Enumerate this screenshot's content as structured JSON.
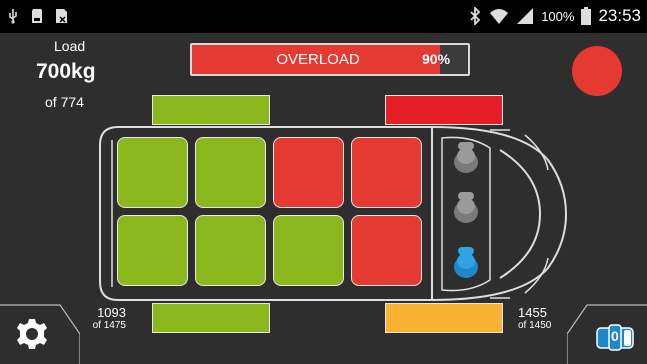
{
  "status_bar": {
    "battery_percent": "100%",
    "time": "23:53",
    "left_icons": [
      "usb-icon",
      "sd-card-icon",
      "sim-icon"
    ],
    "right_icons": [
      "bluetooth-icon",
      "wifi-icon",
      "signal-icon",
      "battery-icon"
    ]
  },
  "load": {
    "title": "Load",
    "value": "700kg",
    "capacity": "of 774"
  },
  "overload_bar": {
    "label": "OVERLOAD",
    "percent_label": "90%",
    "fill_fraction": 0.9,
    "color": "#e53a32"
  },
  "status_indicator": {
    "color": "#e53a32"
  },
  "axles": {
    "front_left_color": "#8cb81f",
    "front_right_color": "#e51e25",
    "rear_left_color": "#8cb81f",
    "rear_right_color": "#f9b233"
  },
  "grid": {
    "rows": [
      [
        "green",
        "green",
        "red",
        "red"
      ],
      [
        "green",
        "green",
        "green",
        "red"
      ]
    ]
  },
  "seats": [
    "gray",
    "gray",
    "blue"
  ],
  "weights": {
    "left": {
      "value": "1093",
      "of": "of 1475"
    },
    "right": {
      "value": "1455",
      "of": "of 1450"
    }
  },
  "buttons": {
    "settings_icon": "gear-icon",
    "toggle_icon": "view-toggle-icon",
    "toggle_value": "0"
  },
  "colors": {
    "green": "#8cb81f",
    "red": "#e53a32",
    "amber": "#f9b233",
    "blue": "#1e88c8",
    "seat_gray": "#7a7a7a"
  }
}
